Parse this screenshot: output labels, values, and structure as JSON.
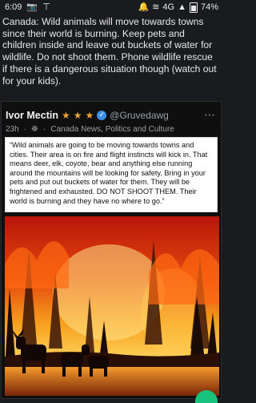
{
  "status_bar": {
    "time": "6:09",
    "network": "4G",
    "battery": "74%",
    "icons": [
      "camera-icon",
      "signal-icon",
      "notification-icon",
      "wifi-icon",
      "cellular-icon",
      "battery-icon"
    ]
  },
  "post": {
    "text": "Canada: Wild animals will move towards towns since their world is burning. Keep pets and children inside and leave out buckets of water for wildlife. Do not shoot them. Phone wildlife rescue if there is a dangerous situation though (watch out for your kids)."
  },
  "embed": {
    "author": "Ivor Mectin",
    "handle": "@Gruvedawg",
    "time": "23h",
    "community": "Canada News, Politics and Culture",
    "quote": "“Wild animals are going to be moving towards towns and cities. Their area is on fire and flight instincts will kick in. That means deer, elk, coyote, bear and anything else running around the mountains will be looking for safety. Bring in your pets and put out buckets of water for them. They will be frightened and exhausted. DO NOT SHOOT THEM. Their world is burning and they have no where to go.”"
  },
  "colors": {
    "background": "#1a1b1f",
    "star": "#e8a23a",
    "verified": "#3b8ee6",
    "fab": "#19c37d"
  }
}
